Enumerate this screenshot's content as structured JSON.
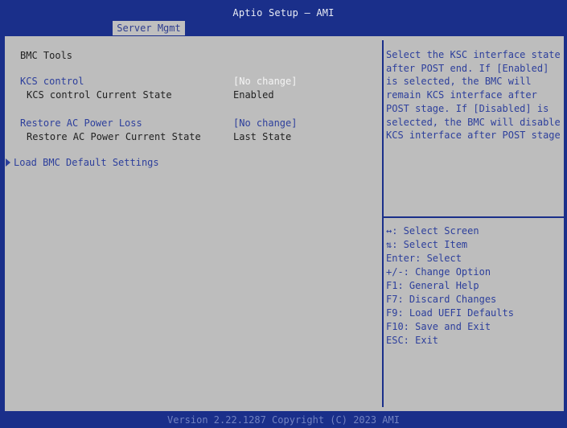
{
  "header": {
    "title": "Aptio Setup – AMI",
    "active_tab": "Server Mgmt"
  },
  "main": {
    "section_title": "BMC Tools",
    "items": {
      "kcs_control": {
        "label": "KCS control",
        "value": "[No change]"
      },
      "kcs_state": {
        "label": "KCS control Current State",
        "value": "Enabled"
      },
      "restore_ac": {
        "label": "Restore AC Power Loss",
        "value": "[No change]"
      },
      "restore_state": {
        "label": "Restore AC Power Current State",
        "value": "Last State"
      },
      "load_defaults": {
        "label": "Load BMC Default Settings"
      }
    }
  },
  "help": {
    "lines": [
      "Select the KSC interface state",
      "after POST end. If [Enabled]",
      "is selected, the BMC will",
      "remain KCS interface after",
      "POST stage. If [Disabled] is",
      "selected, the BMC will disable",
      "KCS interface after POST stage"
    ]
  },
  "keys": {
    "lines": [
      "↔: Select Screen",
      "⇅: Select Item",
      "Enter: Select",
      "+/-: Change Option",
      "F1: General Help",
      "F7: Discard Changes",
      "F9: Load UEFI Defaults",
      "F10: Save and Exit",
      "ESC: Exit"
    ]
  },
  "footer": {
    "text": "Version 2.22.1287 Copyright (C) 2023 AMI"
  },
  "colors": {
    "background": "#1a2f8a",
    "panel": "#bdbdbd",
    "item_blue": "#2d3f9c",
    "value_white": "#f4f4f4"
  },
  "icons": {
    "submenu": "triangle-right-icon"
  }
}
